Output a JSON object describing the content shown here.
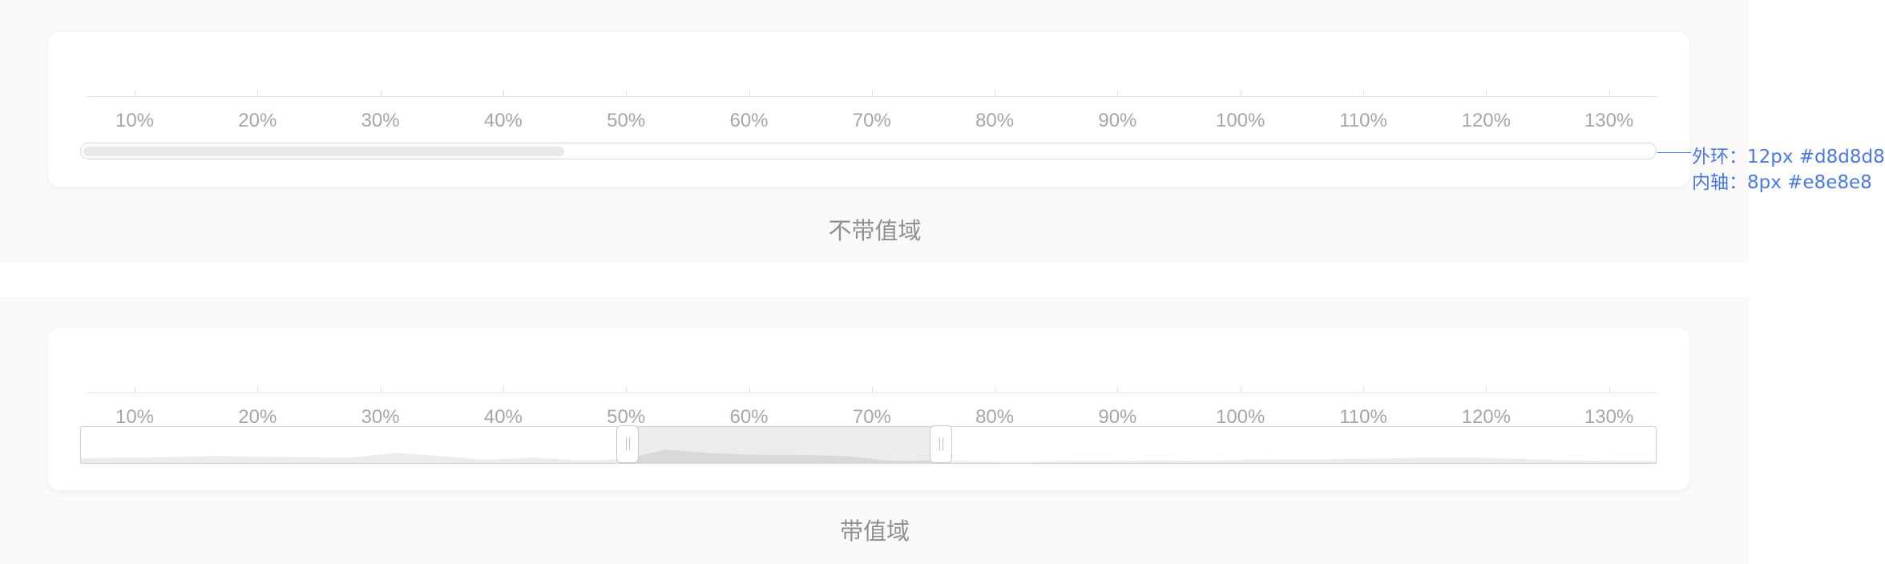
{
  "ticks": [
    "10%",
    "20%",
    "30%",
    "40%",
    "50%",
    "60%",
    "70%",
    "80%",
    "90%",
    "100%",
    "110%",
    "120%",
    "130%"
  ],
  "section1": {
    "caption": "不带值域",
    "scrollbar": {
      "thumb_start_fraction": 0.0,
      "thumb_end_fraction": 0.306
    }
  },
  "section2": {
    "caption": "带值域",
    "range": {
      "start": "50%",
      "end": "76%",
      "start_fraction": 0.347,
      "end_fraction": 0.546
    },
    "handle_grip": "||",
    "area_profile": [
      0.31,
      0.33,
      0.37,
      0.45,
      0.39,
      0.36,
      0.34,
      0.63,
      0.44,
      0.2,
      0.34,
      0.18,
      0.21,
      0.84,
      0.61,
      0.52,
      0.5,
      0.44,
      0.14,
      0.16,
      0.1,
      0.08,
      0.13,
      0.14,
      0.16,
      0.14,
      0.21,
      0.24,
      0.25,
      0.29,
      0.34,
      0.33,
      0.26,
      0.17,
      0.14,
      0.14
    ]
  },
  "annotation": {
    "outer": "外环：12px #d8d8d8",
    "inner": "内轴：8px #e8e8e8"
  },
  "colors": {
    "outer_ring": "#d8d8d8",
    "inner_axis": "#e8e8e8",
    "accent": "#4a78e8"
  }
}
